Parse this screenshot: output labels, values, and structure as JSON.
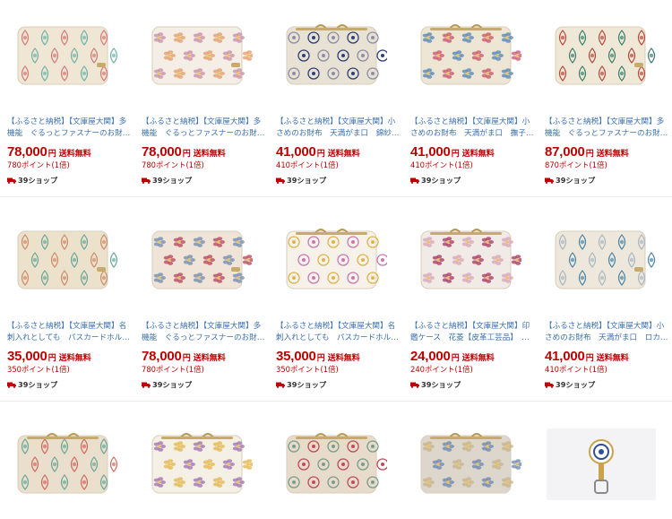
{
  "products": [
    {
      "title_l1": "【ふるさと納税】【文庫屋大関】多",
      "title_l2": "機能　ぐるっとファスナーのお財…",
      "price": "78,000",
      "yen": "円",
      "shipping": "送料無料",
      "points": "780ポイント(1倍)",
      "badge": "39ショップ",
      "palette": [
        "#efe6d4",
        "#6fb3a8",
        "#d27a7a"
      ]
    },
    {
      "title_l1": "【ふるさと納税】【文庫屋大関】多",
      "title_l2": "機能　ぐるっとファスナーのお財…",
      "price": "78,000",
      "yen": "円",
      "shipping": "送料無料",
      "points": "780ポイント(1倍)",
      "badge": "39ショップ",
      "palette": [
        "#f4eee6",
        "#e39a68",
        "#c98aa6"
      ]
    },
    {
      "title_l1": "【ふるさと納税】【文庫屋大関】小",
      "title_l2": "さめのお財布　天満がま口　錦紗…",
      "price": "41,000",
      "yen": "円",
      "shipping": "送料無料",
      "points": "410ポイント(1倍)",
      "badge": "39ショップ",
      "palette": [
        "#e8e2d4",
        "#2f3f78",
        "#8f8da6"
      ]
    },
    {
      "title_l1": "【ふるさと納税】【文庫屋大関】小",
      "title_l2": "さめのお財布　天満がま口　撫子…",
      "price": "41,000",
      "yen": "円",
      "shipping": "送料無料",
      "points": "410ポイント(1倍)",
      "badge": "39ショップ",
      "palette": [
        "#eee6d4",
        "#c84f6c",
        "#4f83b8"
      ]
    },
    {
      "title_l1": "【ふるさと納税】【文庫屋大関】多",
      "title_l2": "機能　ぐるっとファスナーのお財…",
      "price": "87,000",
      "yen": "円",
      "shipping": "送料無料",
      "points": "870ポイント(1倍)",
      "badge": "39ショップ",
      "palette": [
        "#efe8d6",
        "#3d7f6f",
        "#b4493d"
      ]
    },
    {
      "title_l1": "【ふるさと納税】【文庫屋大関】名",
      "title_l2": "刺入れとしても　パスカードホル…",
      "price": "35,000",
      "yen": "円",
      "shipping": "送料無料",
      "points": "350ポイント(1倍)",
      "badge": "39ショップ",
      "palette": [
        "#ece2cc",
        "#6aa698",
        "#cf8a6a"
      ]
    },
    {
      "title_l1": "【ふるさと納税】【文庫屋大関】多",
      "title_l2": "機能　ぐるっとファスナーのお財…",
      "price": "78,000",
      "yen": "円",
      "shipping": "送料無料",
      "points": "780ポイント(1倍)",
      "badge": "39ショップ",
      "palette": [
        "#f0e4d8",
        "#b7415a",
        "#6f8bb0"
      ]
    },
    {
      "title_l1": "【ふるさと納税】【文庫屋大関】名",
      "title_l2": "刺入れとしても　パスカードホル…",
      "price": "35,000",
      "yen": "円",
      "shipping": "送料無料",
      "points": "350ポイント(1倍)",
      "badge": "39ショップ",
      "palette": [
        "#f6f2ea",
        "#c978b4",
        "#e0b34a"
      ]
    },
    {
      "title_l1": "【ふるさと納税】【文庫屋大関】印",
      "title_l2": "鑑ケース　花菱【皮革工芸品】　…",
      "price": "24,000",
      "yen": "円",
      "shipping": "送料無料",
      "points": "240ポイント(1倍)",
      "badge": "39ショップ",
      "palette": [
        "#f0ebe6",
        "#a8325e",
        "#d9a3b8"
      ]
    },
    {
      "title_l1": "【ふるさと納税】【文庫屋大関】小",
      "title_l2": "さめのお財布　天満がま口　ロカ…",
      "price": "41,000",
      "yen": "円",
      "shipping": "送料無料",
      "points": "410ポイント(1倍)",
      "badge": "39ショップ",
      "palette": [
        "#eee8dc",
        "#4b86a8",
        "#a8b7c2"
      ]
    },
    {
      "title_l1": "",
      "title_l2": "",
      "price": "",
      "yen": "",
      "shipping": "",
      "points": "",
      "badge": "",
      "palette": [
        "#eadfcc",
        "#d16a62",
        "#6aa69a"
      ]
    },
    {
      "title_l1": "",
      "title_l2": "",
      "price": "",
      "yen": "",
      "shipping": "",
      "points": "",
      "badge": "",
      "palette": [
        "#f5f0e6",
        "#e3b44b",
        "#9c6fb0"
      ]
    },
    {
      "title_l1": "",
      "title_l2": "",
      "price": "",
      "yen": "",
      "shipping": "",
      "points": "",
      "badge": "",
      "palette": [
        "#e7dccb",
        "#c04a5a",
        "#7a9c8a"
      ]
    },
    {
      "title_l1": "",
      "title_l2": "",
      "price": "",
      "yen": "",
      "shipping": "",
      "points": "",
      "badge": "",
      "palette": [
        "#dcd6cc",
        "#6a84b0",
        "#c8b28a"
      ]
    },
    {
      "title_l1": "",
      "title_l2": "",
      "price": "",
      "yen": "",
      "shipping": "",
      "points": "",
      "badge": "",
      "palette": [
        "#f3f3f5",
        "#2f4e9a",
        "#c9a24a"
      ]
    }
  ]
}
